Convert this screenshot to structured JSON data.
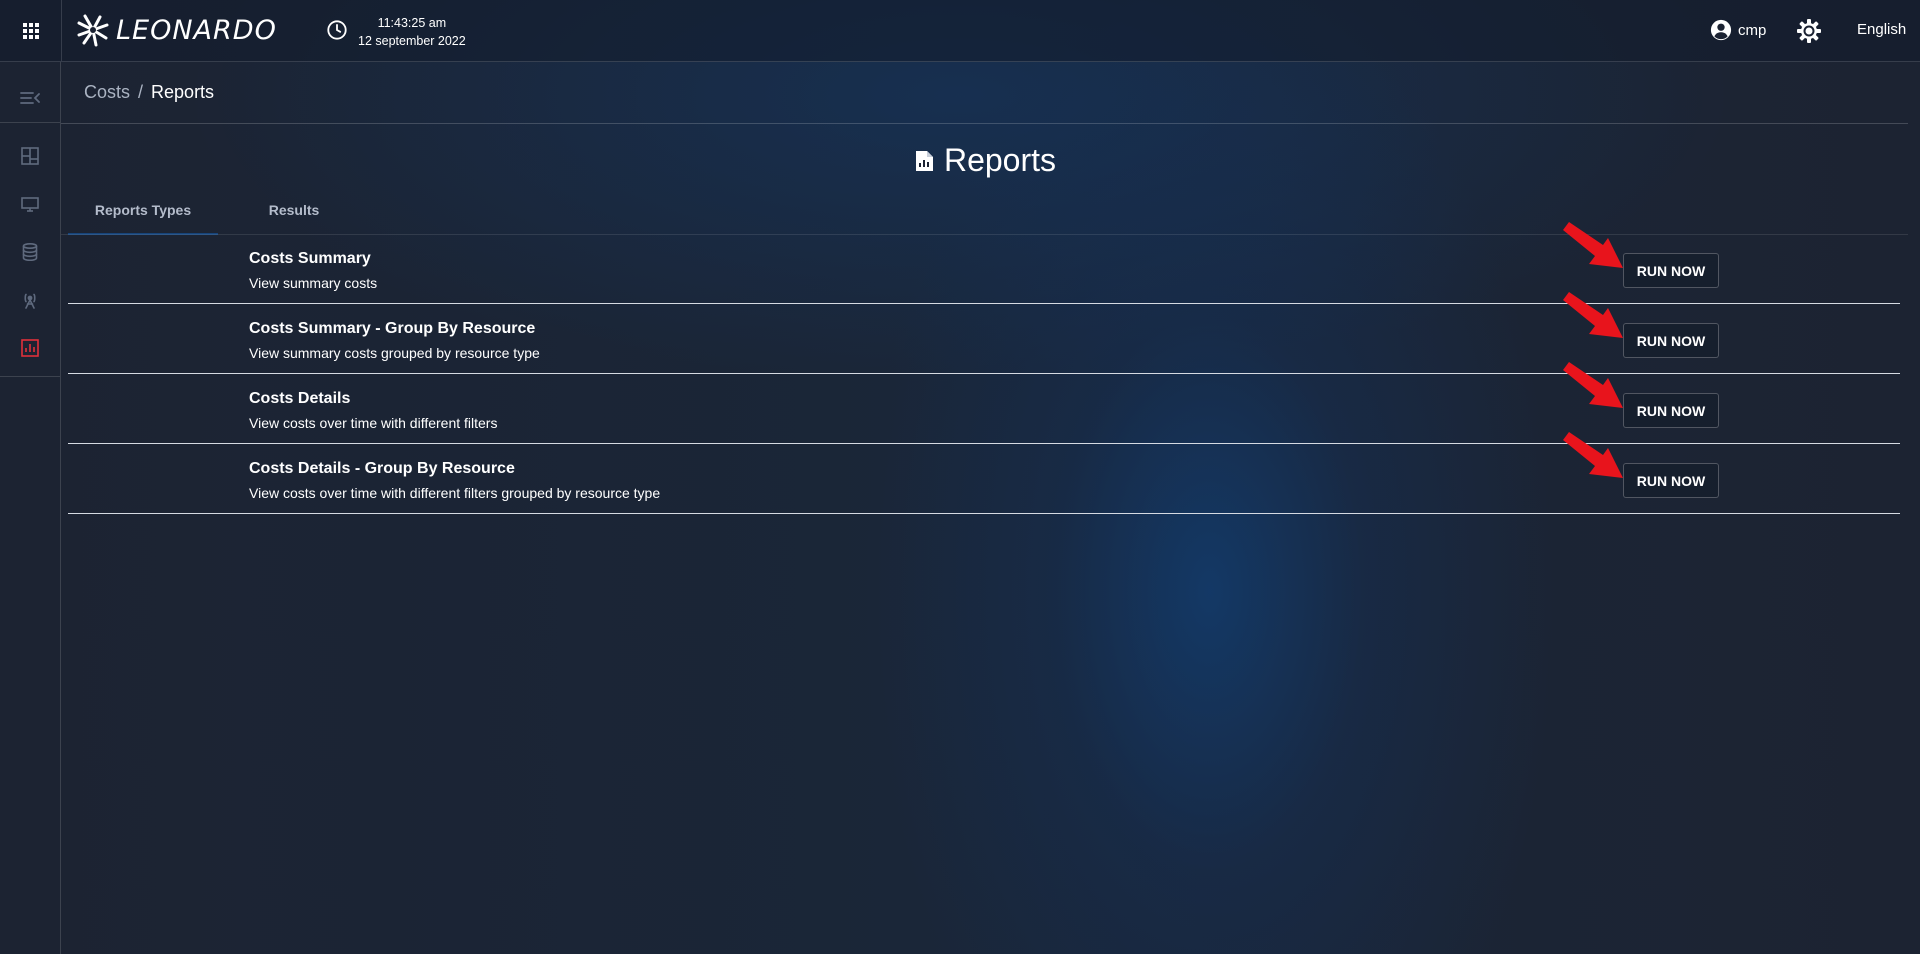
{
  "header": {
    "logo_text": "LEONARDO",
    "time": "11:43:25 am",
    "date": "12 september 2022",
    "user_name": "cmp",
    "language": "English"
  },
  "breadcrumb": {
    "parent": "Costs",
    "separator": "/",
    "current": "Reports"
  },
  "page": {
    "title": "Reports"
  },
  "tabs": [
    {
      "label": "Reports Types",
      "active": true
    },
    {
      "label": "Results",
      "active": false
    }
  ],
  "reports": [
    {
      "title": "Costs Summary",
      "description": "View summary costs",
      "button": "RUN NOW"
    },
    {
      "title": "Costs Summary - Group By Resource",
      "description": "View summary costs grouped by resource type",
      "button": "RUN NOW"
    },
    {
      "title": "Costs Details",
      "description": "View costs over time with different filters",
      "button": "RUN NOW"
    },
    {
      "title": "Costs Details - Group By Resource",
      "description": "View costs over time with different filters grouped by resource type",
      "button": "RUN NOW"
    }
  ],
  "sidebar": {
    "items": [
      {
        "icon": "collapse-menu-icon"
      },
      {
        "icon": "dashboard-icon"
      },
      {
        "icon": "monitor-icon"
      },
      {
        "icon": "database-icon"
      },
      {
        "icon": "antenna-icon"
      },
      {
        "icon": "reports-icon",
        "active": true
      }
    ]
  },
  "colors": {
    "accent_active": "#e0303a",
    "annotation_arrow": "#e8141c",
    "sidebar_icon": "#5f6a7e"
  }
}
